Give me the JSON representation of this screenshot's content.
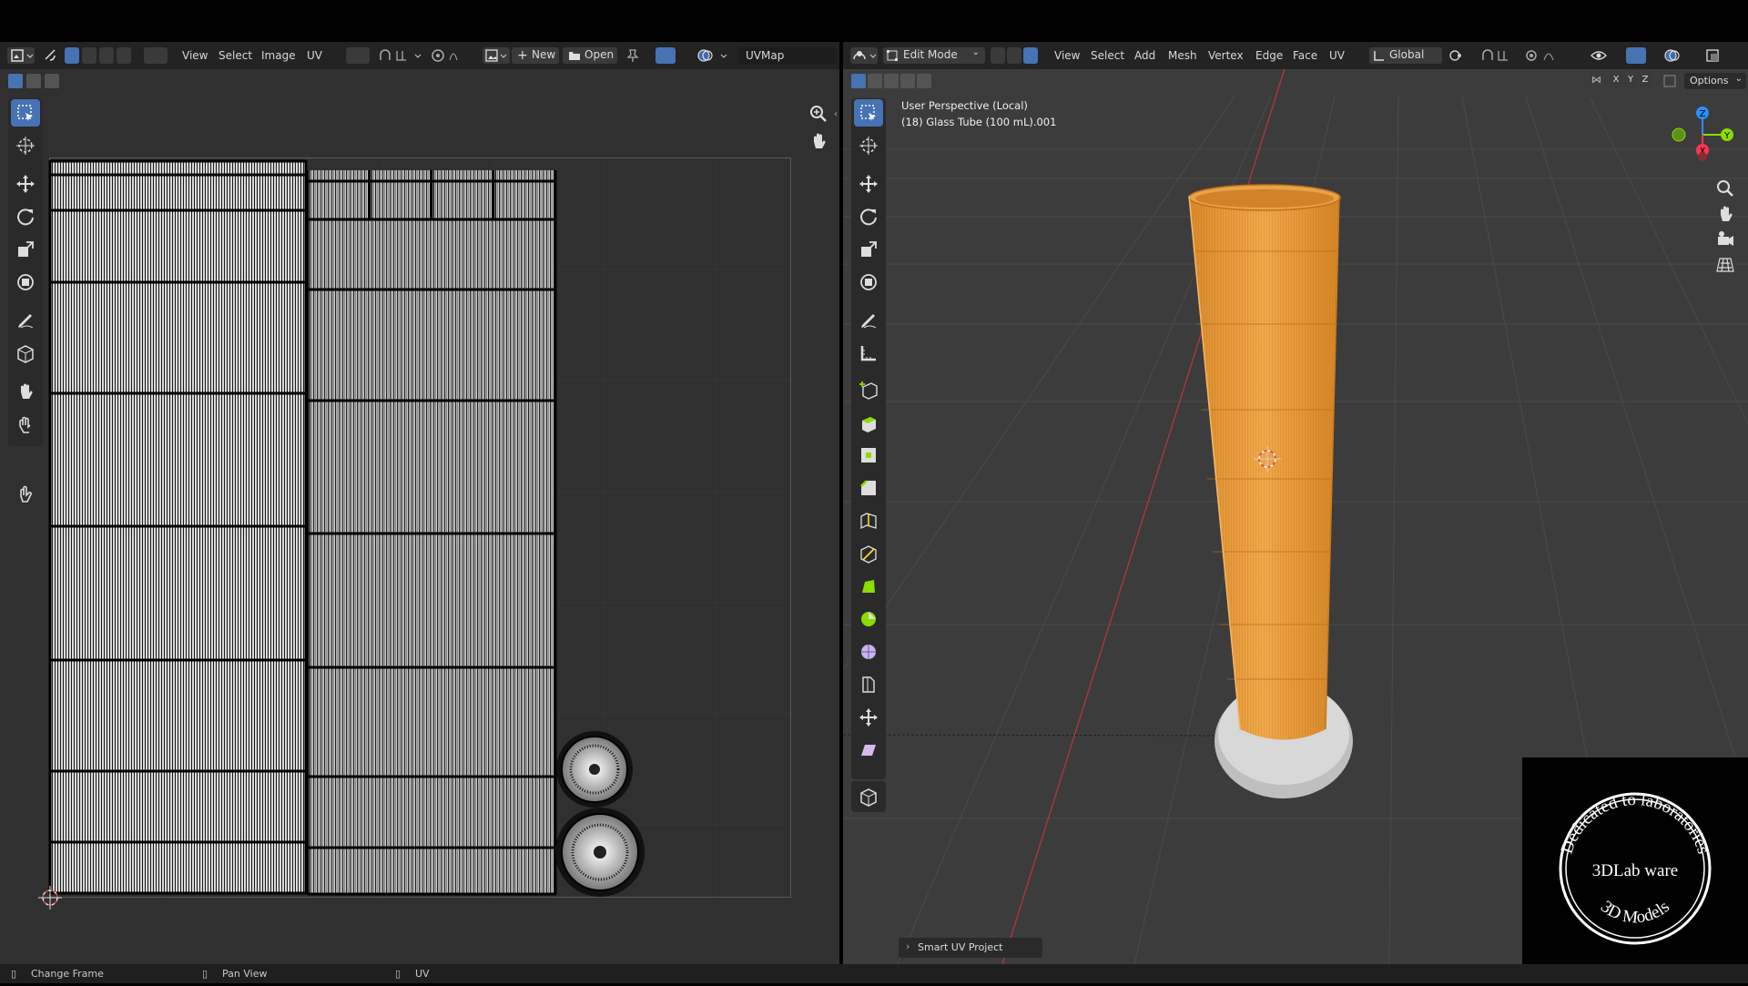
{
  "uv_editor": {
    "menus": [
      "View",
      "Select",
      "Image",
      "UV"
    ],
    "new_label": "New",
    "open_label": "Open",
    "uvmap_name": "UVMap"
  },
  "viewport": {
    "mode_label": "Edit Mode",
    "menus": [
      "View",
      "Select",
      "Add",
      "Mesh",
      "Vertex",
      "Edge",
      "Face",
      "UV"
    ],
    "transform_orientation": "Global",
    "options_label": "Options",
    "axes": [
      "X",
      "Y",
      "Z"
    ],
    "perspective_text": "User Perspective (Local)",
    "object_text": "(18) Glass Tube (100 mL).001",
    "operator_panel_label": "Smart UV Project",
    "gizmo_labels": {
      "x": "X",
      "y": "Y",
      "z": "Z"
    }
  },
  "statusbar": {
    "left": "Change Frame",
    "middle": "Pan View",
    "right": "UV"
  },
  "watermark": {
    "top_text": "Dedicated to laboratories",
    "center_text": "3DLab ware",
    "bottom_text": "3D Models"
  },
  "colors": {
    "accent_blue": "#4772b3",
    "mesh_orange": "#e89a3a",
    "axis_x": "#ff3352",
    "axis_y": "#8bdc00",
    "axis_z": "#2890ff"
  }
}
